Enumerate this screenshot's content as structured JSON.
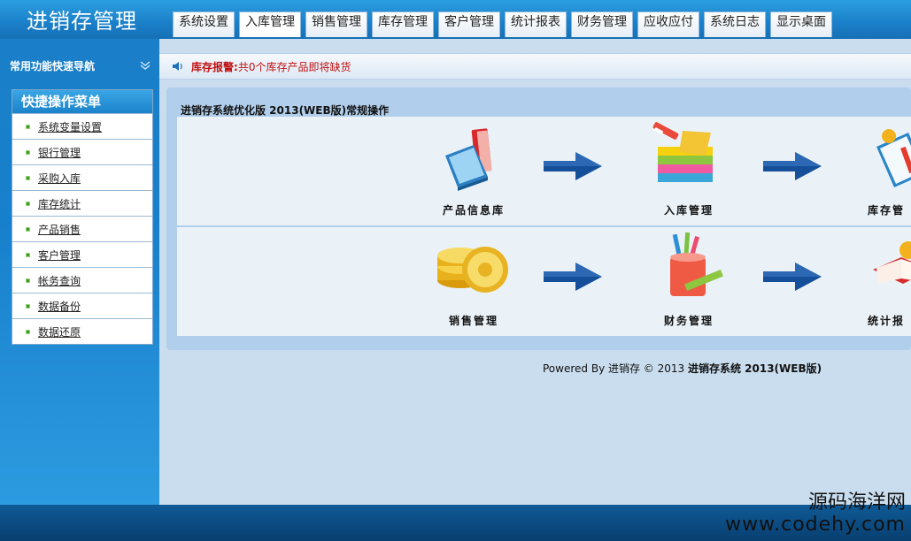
{
  "app": {
    "title": "进销存管理"
  },
  "nav": {
    "tabs": [
      "系统设置",
      "入库管理",
      "销售管理",
      "库存管理",
      "客户管理",
      "统计报表",
      "财务管理",
      "应收应付",
      "系统日志",
      "显示桌面"
    ]
  },
  "sidebar": {
    "header": "常用功能快速导航",
    "menu_title": "快捷操作菜单",
    "items": [
      "系统变量设置",
      "银行管理",
      "采购入库",
      "库存统计",
      "产品销售",
      "客户管理",
      "帐务查询",
      "数据备份",
      "数据还原"
    ]
  },
  "alert": {
    "label": "库存报警:",
    "message": "共0个库存产品即将缺货"
  },
  "panel": {
    "title": "进销存系统优化版 2013(WEB版)常规操作",
    "row1": [
      "产品信息库",
      "入库管理",
      "库存管"
    ],
    "row2": [
      "销售管理",
      "财务管理",
      "统计报"
    ]
  },
  "footer": {
    "text": "Powered By 进销存 © 2013 ",
    "brand": "进销存系统 2013(WEB版)"
  },
  "watermark": {
    "line1": "源码海洋网",
    "line2": "www.codehy.com"
  },
  "colors": {
    "topbar": "#1a7fc8",
    "alert": "#c01111",
    "arrow": "#154f99"
  },
  "icons": {
    "alert": "speaker-icon",
    "arrow": "arrow-right-icon"
  }
}
